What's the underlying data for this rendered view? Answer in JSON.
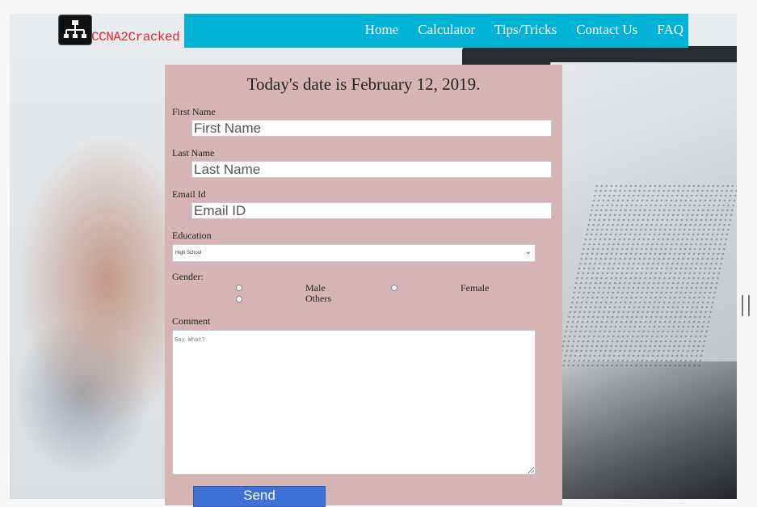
{
  "brand": {
    "name": "CCNA2Cracked",
    "logo_icon": "network-topology-icon"
  },
  "nav": {
    "items": [
      "Home",
      "Calculator",
      "Tips/Tricks",
      "Contact Us",
      "FAQ"
    ]
  },
  "form": {
    "date_text": "Today's date is February 12, 2019.",
    "first_name": {
      "label": "First Name",
      "placeholder": "First Name"
    },
    "last_name": {
      "label": "Last Name",
      "placeholder": "Last Name"
    },
    "email": {
      "label": "Email Id",
      "placeholder": "Email ID"
    },
    "education": {
      "label": "Education",
      "selected": "High School"
    },
    "gender": {
      "label": "Gender:",
      "options": [
        "Male",
        "Female",
        "Others"
      ]
    },
    "comment": {
      "label": "Comment",
      "placeholder": "Say What?"
    },
    "submit_label": "Send"
  },
  "colors": {
    "nav_bg": "#00b2d6",
    "panel_bg": "#d6b4b3",
    "brand_red": "#e8262b",
    "button_bg": "#3f72d8"
  }
}
